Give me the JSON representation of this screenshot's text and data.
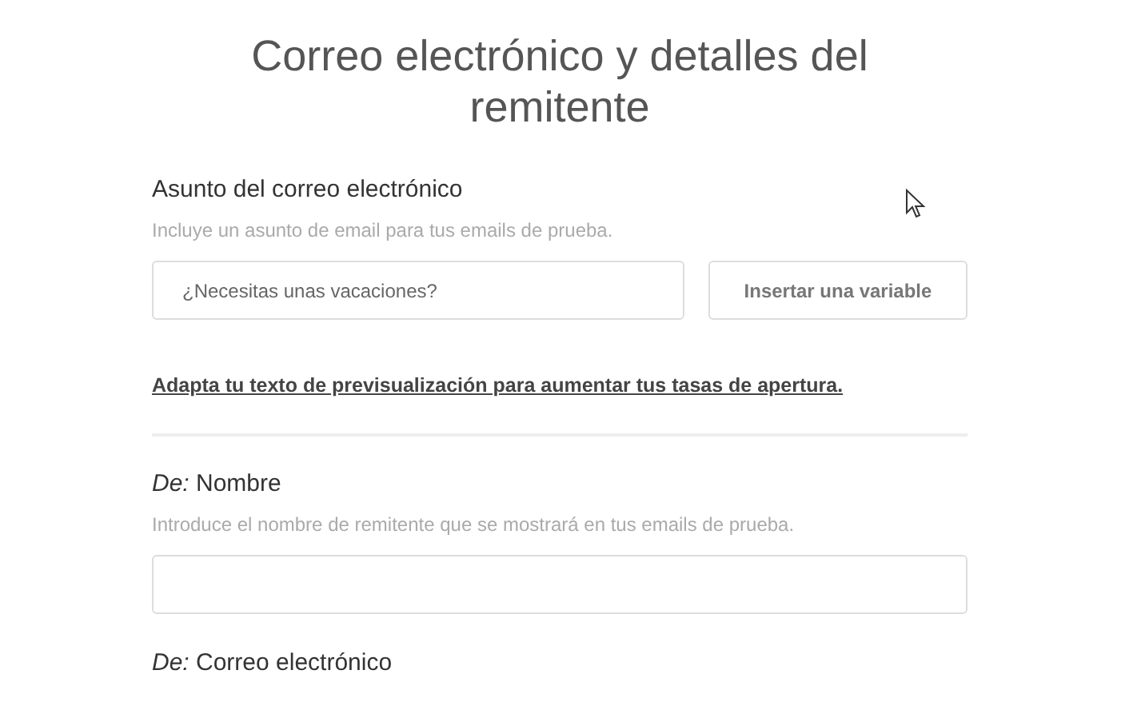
{
  "title": "Correo electrónico y detalles del remitente",
  "subject": {
    "label": "Asunto del correo electrónico",
    "hint": "Incluye un asunto de email para tus emails de prueba.",
    "placeholder": "¿Necesitas unas vacaciones?",
    "button": "Insertar una variable"
  },
  "preview_link": "Adapta tu texto de previsualización para aumentar tus tasas de apertura.",
  "sender_name": {
    "label": "*De:* Nombre",
    "hint": "Introduce el nombre de remitente que se mostrará en tus emails de prueba."
  },
  "sender_email": {
    "label": "*De:* Correo electrónico"
  }
}
